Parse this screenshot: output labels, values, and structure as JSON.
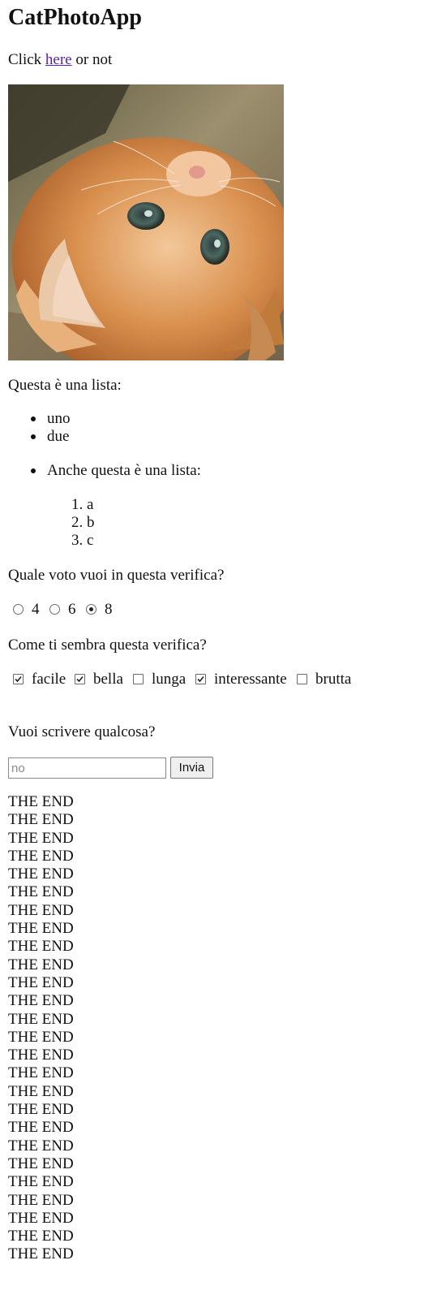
{
  "title": "CatPhotoApp",
  "intro": {
    "before": "Click ",
    "link": "here",
    "after": " or not"
  },
  "list_intro": "Questa è una lista:",
  "unordered": [
    "uno",
    "due"
  ],
  "nested_intro": "Anche questa è una lista:",
  "ordered": [
    {
      "marker": "1.",
      "text": "a"
    },
    {
      "marker": "2.",
      "text": "b"
    },
    {
      "marker": "3.",
      "text": "c"
    }
  ],
  "radio_question": "Quale voto vuoi in questa verifica?",
  "radio_options": [
    {
      "label": "4",
      "checked": false
    },
    {
      "label": "6",
      "checked": false
    },
    {
      "label": "8",
      "checked": true
    }
  ],
  "checkbox_question": "Come ti sembra questa verifica?",
  "checkbox_options": [
    {
      "label": "facile",
      "checked": true
    },
    {
      "label": "bella",
      "checked": true
    },
    {
      "label": "lunga",
      "checked": false
    },
    {
      "label": "interessante",
      "checked": true
    },
    {
      "label": "brutta",
      "checked": false
    }
  ],
  "text_question": "Vuoi scrivere qualcosa?",
  "text_input": {
    "placeholder": "no",
    "value": ""
  },
  "submit_label": "Invia",
  "end_text": "THE END",
  "end_lines": [
    "THE END",
    "THE END",
    "THE END",
    "THE END",
    "THE END",
    "THE END",
    "THE END",
    "THE END",
    "THE END",
    "THE END",
    "THE END",
    "THE END",
    "THE END",
    "THE END",
    "THE END",
    "THE END",
    "THE END",
    "THE END",
    "THE END",
    "THE END",
    "THE END",
    "THE END",
    "THE END",
    "THE END",
    "THE END",
    "THE END"
  ]
}
